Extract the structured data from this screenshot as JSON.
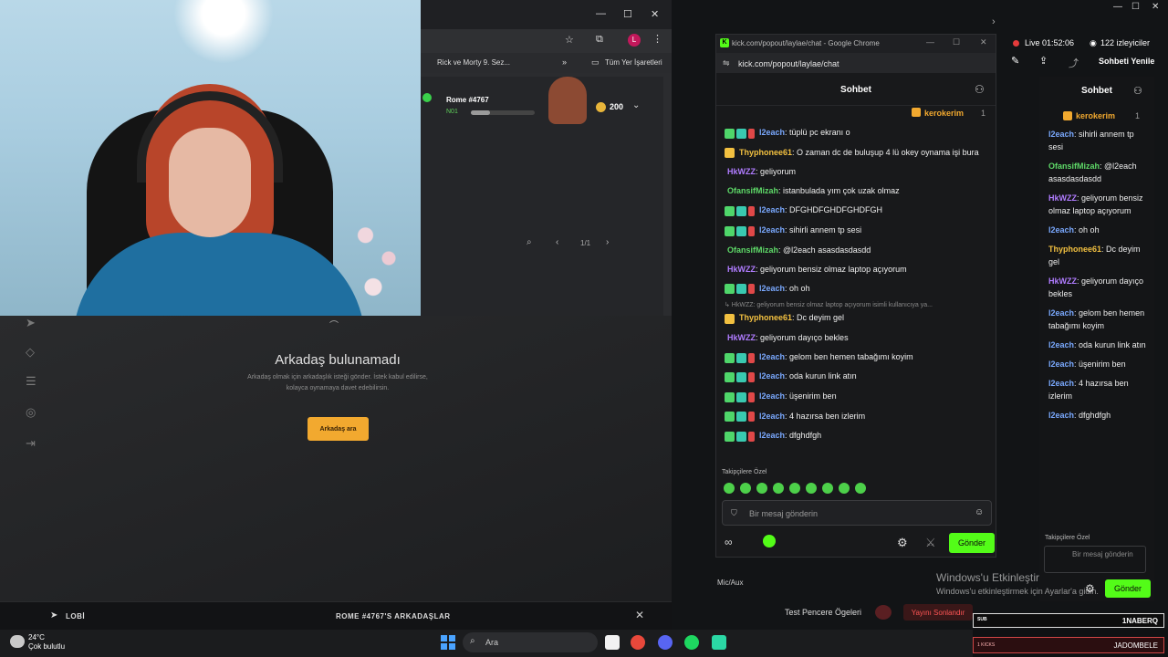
{
  "browser1": {
    "bookmark_rick": "Rick ve Morty 9. Sez...",
    "bookmark_all": "Tüm Yer İşaretleri",
    "player_name": "Rome #4767",
    "player_level": "N01",
    "player_progress": 0.3,
    "coins": "200",
    "pager": "1/1"
  },
  "game": {
    "empty_title": "Arkadaş bulunamadı",
    "empty_desc": "Arkadaş olmak için arkadaşlık isteği gönder. İstek kabul edilirse, kolayca oynamaya davet edebilirsin.",
    "find_button": "Arkadaş ara",
    "lobby": "LOBİ",
    "friends_of": "ROME #4767'S ARKADAŞLAR"
  },
  "kick": {
    "window_title": "kick.com/popout/laylae/chat - Google Chrome",
    "url": "kick.com/popout/laylae/chat",
    "header": "Sohbet",
    "pinned_user": "kerokerim",
    "pinned_count": "1",
    "messages": [
      {
        "badges": [
          "green",
          "teal",
          "red"
        ],
        "user": "l2each",
        "color": "blue",
        "text": "tüplü pc ekranı o"
      },
      {
        "badges": [
          "yellow"
        ],
        "user": "Thyphonee61",
        "color": "yellow",
        "text": "O zaman dc de buluşup 4 lü okey oynama işi bura"
      },
      {
        "badges": [],
        "user": "HkWZZ",
        "color": "purple",
        "text": "geliyorum"
      },
      {
        "badges": [],
        "user": "OfansifMizah",
        "color": "green",
        "text": "istanbulada yım çok uzak olmaz"
      },
      {
        "badges": [
          "green",
          "teal",
          "red"
        ],
        "user": "l2each",
        "color": "blue",
        "text": "DFGHDFGHDFGHDFGH"
      },
      {
        "badges": [
          "green",
          "teal",
          "red"
        ],
        "user": "l2each",
        "color": "blue",
        "text": "sihirli annem tp sesi"
      },
      {
        "badges": [],
        "user": "OfansifMizah",
        "color": "green",
        "text": "@l2each asasdasdasdd"
      },
      {
        "badges": [],
        "user": "HkWZZ",
        "color": "purple",
        "text": "geliyorum bensiz olmaz laptop açıyorum"
      },
      {
        "badges": [
          "green",
          "teal",
          "red"
        ],
        "user": "l2each",
        "color": "blue",
        "text": "oh oh"
      },
      {
        "reply": "↳ HkWZZ: geliyorum bensiz olmaz laptop açıyorum isimli kullanıcıya ya...",
        "badges": [
          "yellow"
        ],
        "user": "Thyphonee61",
        "color": "yellow",
        "text": "Dc deyim gel"
      },
      {
        "badges": [],
        "user": "HkWZZ",
        "color": "purple",
        "text": "geliyorum dayıço bekles"
      },
      {
        "badges": [
          "green",
          "teal",
          "red"
        ],
        "user": "l2each",
        "color": "blue",
        "text": "gelom ben hemen tabağımı koyim"
      },
      {
        "badges": [
          "green",
          "teal",
          "red"
        ],
        "user": "l2each",
        "color": "blue",
        "text": "oda kurun link atın"
      },
      {
        "badges": [
          "green",
          "teal",
          "red"
        ],
        "user": "l2each",
        "color": "blue",
        "text": "üşenirim ben"
      },
      {
        "badges": [
          "green",
          "teal",
          "red"
        ],
        "user": "l2each",
        "color": "blue",
        "text": "4 hazırsa ben izlerim"
      },
      {
        "badges": [
          "green",
          "teal",
          "red"
        ],
        "user": "l2each",
        "color": "blue",
        "text": "dfghdfgh"
      }
    ],
    "emote_section": "Takipçilere Özel",
    "input_placeholder": "Bir mesaj gönderin",
    "send": "Gönder"
  },
  "overlay": {
    "live": "Live 01:52:06",
    "viewers": "122 izleyiciler",
    "refresh_chat": "Sohbeti Yenile",
    "chat_title": "Sohbet",
    "pinned_user": "kerokerim",
    "pinned_count": "1",
    "messages": [
      {
        "user": "l2each",
        "color": "blue",
        "text": "sihirli annem tp sesi"
      },
      {
        "user": "OfansifMizah",
        "color": "green",
        "text": "@l2each asasdasdasdd"
      },
      {
        "user": "HkWZZ",
        "color": "purple",
        "text": "geliyorum bensiz olmaz laptop açıyorum"
      },
      {
        "user": "l2each",
        "color": "blue",
        "text": "oh oh"
      },
      {
        "user": "Thyphonee61",
        "color": "yellow",
        "text": "Dc deyim gel"
      },
      {
        "user": "HkWZZ",
        "color": "purple",
        "text": "geliyorum dayıço bekles"
      },
      {
        "user": "l2each",
        "color": "blue",
        "text": "gelom ben hemen tabağımı koyim"
      },
      {
        "user": "l2each",
        "color": "blue",
        "text": "oda kurun link atın"
      },
      {
        "user": "l2each",
        "color": "blue",
        "text": "üşenirim ben"
      },
      {
        "user": "l2each",
        "color": "blue",
        "text": "4 hazırsa ben izlerim"
      },
      {
        "user": "l2each",
        "color": "blue",
        "text": "dfghdfgh"
      }
    ],
    "follower_only": "Takipçilere Özel",
    "input_placeholder": "Bir mesaj gönderin",
    "send": "Gönder",
    "mic_aux": "Mic/Aux",
    "test_elements": "Test Pencere Ögeleri",
    "end_stream": "Yayını Sonlandır",
    "win_activate": "Windows'u Etkinleştir",
    "win_activate_sub": "Windows'u etkinleştirmek için Ayarlar'a gidin.",
    "sub_label": "SUB",
    "sub_name": "1NABERQ",
    "kicks_label": "1 KICKS",
    "kicks_name": "JADOMBELE"
  },
  "taskbar": {
    "temp": "24°C",
    "weather": "Çok bulutlu",
    "search": "Ara"
  },
  "colors": {
    "kick_green": "#53fc18",
    "accent_orange": "#f2a92f",
    "live_red": "#e53b3b"
  }
}
